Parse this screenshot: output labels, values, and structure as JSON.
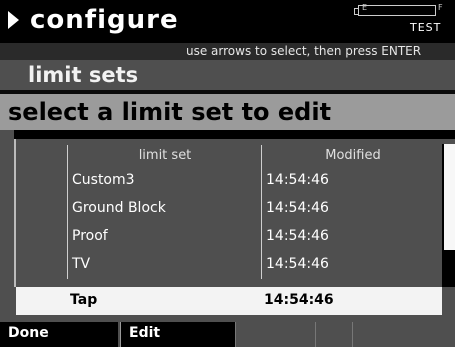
{
  "header": {
    "title": "configure",
    "battery": {
      "empty_label": "E",
      "full_label": "F"
    },
    "status_label": "TEST"
  },
  "instructions": "use arrows to select, then press ENTER",
  "subheader": "limit sets",
  "heading": "select a limit set to edit",
  "table": {
    "columns": [
      "limit set",
      "Modified"
    ],
    "rows": [
      {
        "name": "Custom3",
        "modified": "14:54:46"
      },
      {
        "name": "Ground Block",
        "modified": "14:54:46"
      },
      {
        "name": "Proof",
        "modified": "14:54:46"
      },
      {
        "name": "TV",
        "modified": "14:54:46"
      },
      {
        "name": "Tap",
        "modified": "14:54:46"
      }
    ],
    "selected_index": 4
  },
  "softkeys": [
    "Done",
    "Edit",
    "",
    "",
    ""
  ]
}
